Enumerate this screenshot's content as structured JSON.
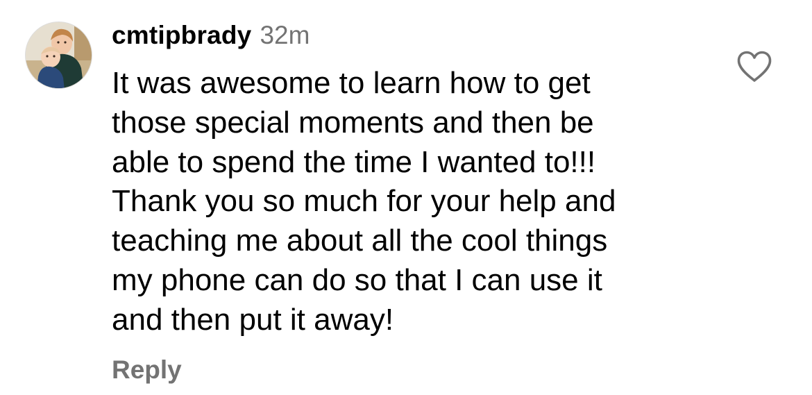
{
  "comment": {
    "username": "cmtipbrady",
    "timestamp": "32m",
    "text": "It was awesome to learn how to get\nthose special moments and then be\nable to spend the time I wanted to!!!\nThank you so much for your help and\nteaching me about all the cool things\nmy phone can do so that I can use it\nand then put it away!",
    "reply_label": "Reply",
    "like_icon": "heart-outline-icon",
    "liked": false
  },
  "colors": {
    "text": "#000000",
    "secondary": "#737373",
    "icon": "#737373",
    "background": "#ffffff"
  }
}
